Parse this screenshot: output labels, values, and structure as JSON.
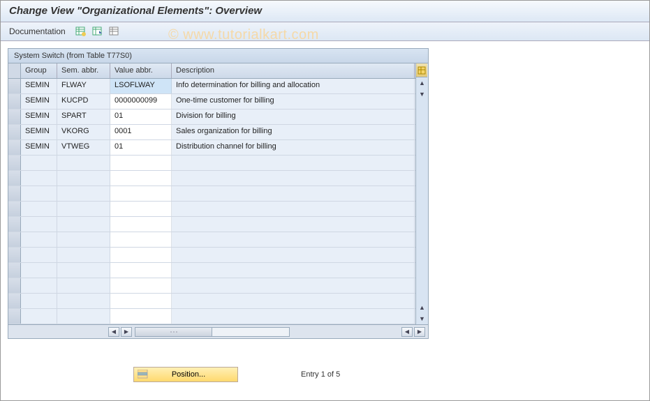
{
  "title": "Change View \"Organizational Elements\": Overview",
  "toolbar": {
    "documentation_label": "Documentation"
  },
  "panel": {
    "title": "System Switch (from Table T77S0)"
  },
  "columns": {
    "group": "Group",
    "sem": "Sem. abbr.",
    "val": "Value abbr.",
    "desc": "Description"
  },
  "rows": [
    {
      "group": "SEMIN",
      "sem": "FLWAY",
      "val": "LSOFLWAY",
      "desc": "Info determination for billing and allocation"
    },
    {
      "group": "SEMIN",
      "sem": "KUCPD",
      "val": "0000000099",
      "desc": "One-time customer for billing"
    },
    {
      "group": "SEMIN",
      "sem": "SPART",
      "val": "01",
      "desc": "Division for billing"
    },
    {
      "group": "SEMIN",
      "sem": "VKORG",
      "val": "0001",
      "desc": "Sales organization for billing"
    },
    {
      "group": "SEMIN",
      "sem": "VTWEG",
      "val": "01",
      "desc": "Distribution channel for billing"
    }
  ],
  "empty_row_count": 11,
  "position": {
    "button_label": "Position...",
    "entry_text": "Entry 1 of 5"
  },
  "watermark": "© www.tutorialkart.com"
}
